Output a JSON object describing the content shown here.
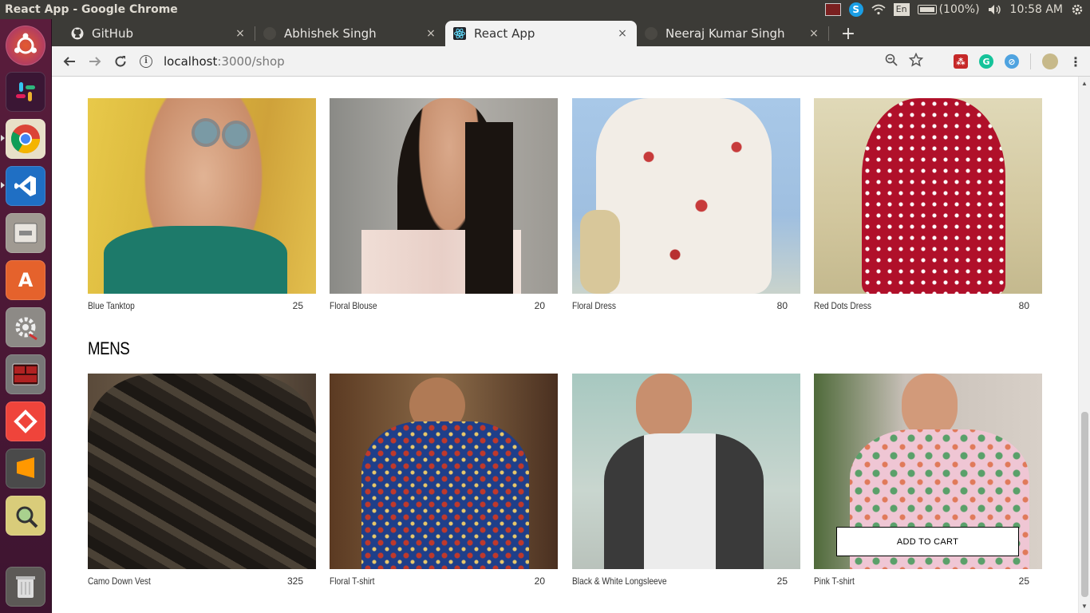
{
  "top_panel": {
    "title": "React App - Google Chrome",
    "battery": "(100%)",
    "time": "10:58 AM",
    "lang": "En"
  },
  "launcher": {
    "items": [
      "ubuntu-icon",
      "slack-icon",
      "chrome-icon",
      "vscode-icon",
      "files-icon",
      "software-center-icon",
      "settings-icon",
      "terminal-icon",
      "anydesk-icon",
      "sublime-icon",
      "image-viewer-icon",
      "trash-icon"
    ]
  },
  "tabs": [
    {
      "label": "GitHub",
      "icon": "github-icon",
      "close": "×"
    },
    {
      "label": "Abhishek Singh",
      "icon": "github-icon",
      "close": "×"
    },
    {
      "label": "React App",
      "icon": "react-icon",
      "close": "×"
    },
    {
      "label": "Neeraj Kumar Singh",
      "icon": "github-icon",
      "close": "×"
    }
  ],
  "toolbar": {
    "url_host": "localhost",
    "url_path": ":3000/shop"
  },
  "shop": {
    "women": {
      "items": [
        {
          "name": "Blue Tanktop",
          "price": "25"
        },
        {
          "name": "Floral Blouse",
          "price": "20"
        },
        {
          "name": "Floral Dress",
          "price": "80"
        },
        {
          "name": "Red Dots Dress",
          "price": "80"
        }
      ]
    },
    "mens": {
      "title": "MENS",
      "items": [
        {
          "name": "Camo Down Vest",
          "price": "325"
        },
        {
          "name": "Floral T-shirt",
          "price": "20"
        },
        {
          "name": "Black & White Longsleeve",
          "price": "25"
        },
        {
          "name": "Pink T-shirt",
          "price": "25"
        }
      ]
    },
    "add_to_cart_label": "ADD TO CART"
  }
}
